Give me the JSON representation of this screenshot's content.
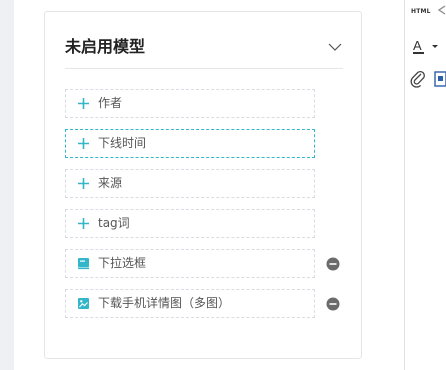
{
  "panel": {
    "title": "未启用模型",
    "fields": [
      {
        "label": "作者",
        "icon": "plus-icon"
      },
      {
        "label": "下线时间",
        "icon": "plus-icon"
      },
      {
        "label": "来源",
        "icon": "plus-icon"
      },
      {
        "label": "tag词",
        "icon": "plus-icon"
      },
      {
        "label": "下拉选框",
        "icon": "select-box-icon"
      },
      {
        "label": "下载手机详情图（多图）",
        "icon": "image-gallery-icon"
      }
    ]
  },
  "toolbar": {
    "html_label": "HTML",
    "font_color_letter": "A"
  },
  "colors": {
    "accent": "#33b6c9",
    "remove": "#6b6b6b",
    "highlight_border": "#33b6c9"
  }
}
